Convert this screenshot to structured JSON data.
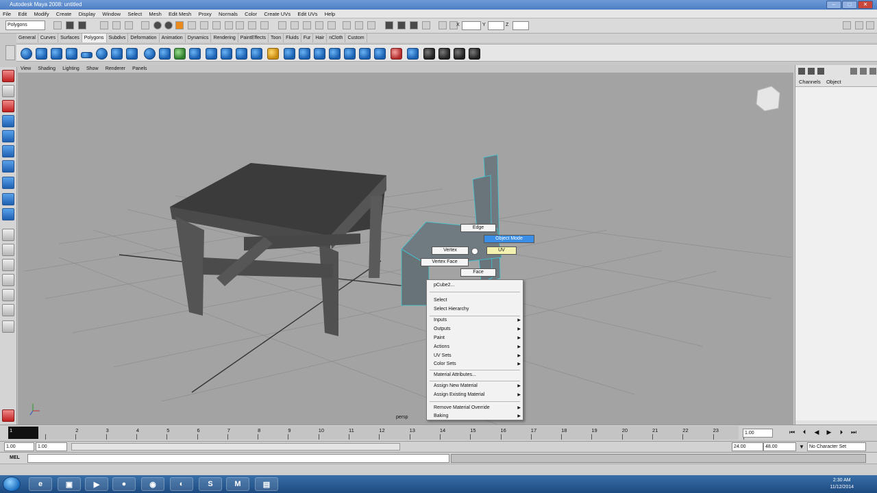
{
  "window": {
    "title": "Autodesk Maya 2008: untitled",
    "minimize": "–",
    "maximize": "□",
    "close": "✕"
  },
  "menu": [
    "File",
    "Edit",
    "Modify",
    "Create",
    "Display",
    "Window",
    "Select",
    "Mesh",
    "Edit Mesh",
    "Proxy",
    "Normals",
    "Color",
    "Create UVs",
    "Edit UVs",
    "Help"
  ],
  "statusline": {
    "mode_select": "Polygons",
    "field_x_label": "X",
    "field_y_label": "Y",
    "field_z_label": "Z"
  },
  "shelf_tabs": [
    "General",
    "Curves",
    "Surfaces",
    "Polygons",
    "Subdivs",
    "Deformation",
    "Animation",
    "Dynamics",
    "Rendering",
    "PaintEffects",
    "Toon",
    "Fluids",
    "Fur",
    "Hair",
    "nCloth",
    "Custom"
  ],
  "shelf_active_tab": "Polygons",
  "panel_menu": [
    "View",
    "Shading",
    "Lighting",
    "Show",
    "Renderer",
    "Panels"
  ],
  "viewport": {
    "camera_label": "persp",
    "background": "#a3a3a3"
  },
  "marking_menu": {
    "edge": "Edge",
    "object_mode": "Object Mode",
    "vertex": "Vertex",
    "uv": "UV",
    "vertex_face": "Vertex Face",
    "face": "Face"
  },
  "context_menu": {
    "header": "pCube2...",
    "items": [
      {
        "label": "Select",
        "submenu": false
      },
      {
        "label": "Select Hierarchy",
        "submenu": false
      },
      {
        "label": "Inputs",
        "submenu": true
      },
      {
        "label": "Outputs",
        "submenu": true
      },
      {
        "label": "Paint",
        "submenu": true
      },
      {
        "label": "Actions",
        "submenu": true
      },
      {
        "label": "UV Sets",
        "submenu": true
      },
      {
        "label": "Color Sets",
        "submenu": true
      },
      {
        "label": "Material Attributes...",
        "submenu": false
      },
      {
        "label": "Assign New Material",
        "submenu": true
      },
      {
        "label": "Assign Existing Material",
        "submenu": true
      },
      {
        "label": "Remove Material Override",
        "submenu": true
      },
      {
        "label": "Baking",
        "submenu": true
      }
    ]
  },
  "channel_box": {
    "tabs": [
      "Channels",
      "Object"
    ]
  },
  "timeline": {
    "ticks": [
      "1",
      "2",
      "3",
      "4",
      "5",
      "6",
      "7",
      "8",
      "9",
      "10",
      "11",
      "12",
      "13",
      "14",
      "15",
      "16",
      "17",
      "18",
      "19",
      "20",
      "21",
      "22",
      "23",
      "24"
    ],
    "current_frame": "1.00"
  },
  "range": {
    "start": "1.00",
    "playback_start": "1.00",
    "playback_end": "24.00",
    "end": "48.00",
    "character_set": "No Character Set"
  },
  "cmdline": {
    "language": "MEL"
  },
  "taskbar": {
    "time": "2:30 AM",
    "date": "11/12/2014"
  }
}
